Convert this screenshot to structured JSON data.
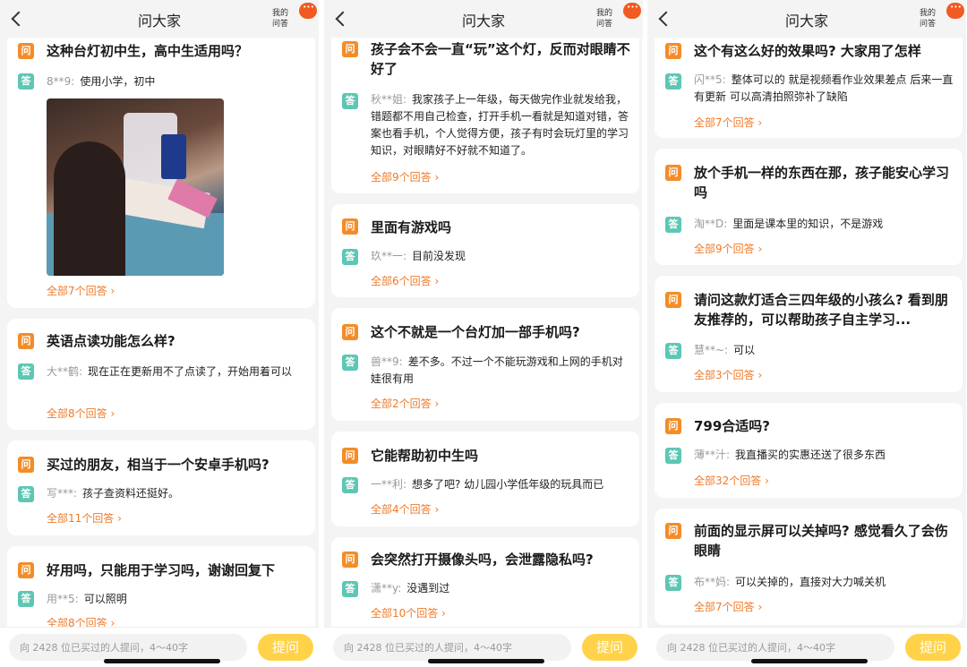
{
  "panels": [
    {
      "header": {
        "title": "问大家",
        "my_qa_line1": "我的",
        "my_qa_line2": "问答"
      },
      "search": {
        "placeholder": "向 2428 位已买过的人提问，4～40字"
      },
      "ask_label": "提问",
      "photo_icon": "child-at-desk-photo",
      "cards": [
        {
          "question": "这种台灯初中生，高中生适用吗？",
          "user": "8**9:",
          "answer": "使用小学，初中",
          "more": "全部7个回答",
          "has_photo": true
        },
        {
          "question": "英语点读功能怎么样?",
          "user": "大**鹤:",
          "answer": "现在正在更新用不了点读了，开始用着可以",
          "more": "全部8个回答"
        },
        {
          "question": "买过的朋友，相当于一个安卓手机吗?",
          "user": "写***:",
          "answer": "孩子查资料还挺好。",
          "more": "全部11个回答"
        },
        {
          "question": "好用吗，只能用于学习吗，谢谢回复下",
          "user": "用**5:",
          "answer": "可以照明",
          "more": "全部8个回答"
        }
      ]
    },
    {
      "header": {
        "title": "问大家",
        "my_qa_line1": "我的",
        "my_qa_line2": "问答"
      },
      "search": {
        "placeholder": "向 2428 位已买过的人提问，4～40字"
      },
      "ask_label": "提问",
      "cards": [
        {
          "question": "孩子会不会一直“玩”这个灯，反而对眼睛不好了",
          "user": "秋**姐:",
          "answer": "我家孩子上一年级，每天做完作业就发给我，错题都不用自己检查，打开手机一看就是知道对错，答案也看手机，个人觉得方便，孩子有时会玩灯里的学习知识，对眼睛好不好就不知道了。",
          "more": "全部9个回答"
        },
        {
          "question": "里面有游戏吗",
          "user": "玖**一:",
          "answer": "目前没发现",
          "more": "全部6个回答"
        },
        {
          "question": "这个不就是一个台灯加一部手机吗?",
          "user": "兽**9:",
          "answer": "差不多。不过一个不能玩游戏和上网的手机对娃很有用",
          "more": "全部2个回答"
        },
        {
          "question": "它能帮助初中生吗",
          "user": "一**利:",
          "answer": "想多了吧? 幼儿园小学低年级的玩具而已",
          "more": "全部4个回答"
        },
        {
          "question": "会突然打开摄像头吗，会泄露隐私吗?",
          "user": "潇**y:",
          "answer": "没遇到过",
          "more": "全部10个回答"
        }
      ]
    },
    {
      "header": {
        "title": "问大家",
        "my_qa_line1": "我的",
        "my_qa_line2": "问答"
      },
      "search": {
        "placeholder": "向 2428 位已买过的人提问，4～40字"
      },
      "ask_label": "提问",
      "cards": [
        {
          "question": "这个有这么好的效果吗? 大家用了怎样",
          "user": "闪**5:",
          "answer": "整体可以的 就是视频看作业效果差点 后来一直有更新 可以高清拍照弥补了缺陷",
          "more": "全部7个回答"
        },
        {
          "question": "放个手机一样的东西在那，孩子能安心学习吗",
          "user": "淘**D:",
          "answer": "里面是课本里的知识，不是游戏",
          "more": "全部9个回答"
        },
        {
          "question": "请问这款灯适合三四年级的小孩么? 看到朋友推荐的，可以帮助孩子自主学习...",
          "user": "慧**~:",
          "answer": "可以",
          "more": "全部3个回答"
        },
        {
          "question": "799合适吗?",
          "user": "薄**汁:",
          "answer": "我直播买的实惠还送了很多东西",
          "more": "全部32个回答"
        },
        {
          "question": "前面的显示屏可以关掉吗? 感觉看久了会伤眼睛",
          "user": "布**妈:",
          "answer": "可以关掉的，直接对大力喊关机",
          "more": "全部7个回答"
        }
      ]
    }
  ],
  "icons": {
    "question": "问",
    "answer": "答"
  },
  "colors": {
    "accent_orange": "#f48c28",
    "answer_green": "#5ec6b4",
    "link_orange": "#ef7a2a",
    "ask_yellow": "#ffd24a",
    "menu_red": "#f25a22"
  }
}
